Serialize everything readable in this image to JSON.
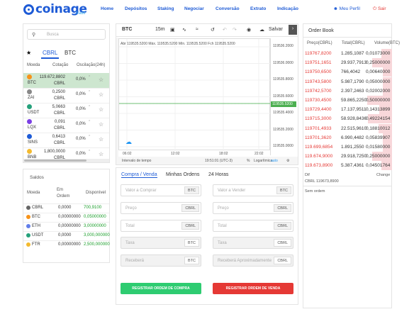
{
  "brand": {
    "name": "coinage",
    "sub": "trade"
  },
  "nav": {
    "items": [
      "Home",
      "Depósitos",
      "Staking",
      "Negociar",
      "Conversão",
      "Extrato",
      "Indicação"
    ],
    "user": "Meu Perfil",
    "exit": "Sair"
  },
  "market": {
    "search_placeholder": "Busca",
    "tabs": [
      "CBRL",
      "BTC"
    ],
    "headers": [
      "Moeda",
      "Cotação",
      "Oscilação(24h)"
    ],
    "rows": [
      {
        "sym": "BTC",
        "price1": "119.672,8802",
        "price2": "CBRL",
        "var": "0,0%",
        "color": "#f7931a"
      },
      {
        "sym": "ZAI",
        "price1": "0,2500",
        "price2": "CBRL",
        "var": "0,0%",
        "color": "#888888"
      },
      {
        "sym": "USDT",
        "price1": "5,0663",
        "price2": "CBRL",
        "var": "0,0%",
        "color": "#26a17b"
      },
      {
        "sym": "LQX",
        "price1": "0,091",
        "price2": "CBRL",
        "var": "0,0%",
        "color": "#7b3fe4"
      },
      {
        "sym": "SINS",
        "price1": "0,6413",
        "price2": "CBRL",
        "var": "0,0%",
        "color": "#1e5bd6"
      },
      {
        "sym": "BNB",
        "price1": "1,800,0000",
        "price2": "CBRL",
        "var": "0,0%",
        "color": "#f3ba2f"
      }
    ]
  },
  "balances": {
    "title": "Saldos",
    "headers": [
      "Moeda",
      "Em Ordem",
      "Disponível"
    ],
    "rows": [
      {
        "sym": "CBRL",
        "in_order": "0,0000",
        "avail": "700,9100",
        "color": "#666666"
      },
      {
        "sym": "BTC",
        "in_order": "0,00000000",
        "avail": "0,05000000",
        "color": "#f7931a"
      },
      {
        "sym": "ETH",
        "in_order": "0,00000000",
        "avail": "3,00000000",
        "color": "#627eea"
      },
      {
        "sym": "USDT",
        "in_order": "0,0000",
        "avail": "3,000,000000",
        "color": "#26a17b"
      },
      {
        "sym": "FTR",
        "in_order": "0,00000000",
        "avail": "2,500,000000",
        "color": "#f3ba2f"
      }
    ]
  },
  "chart": {
    "symbol": "BTC",
    "interval": "15m",
    "save": "Salvar",
    "legend": "Abr 119535.5200  Máx. 119535.5200  Mín. 119535.5200  Fch 119535.5200",
    "yticks": [
      "119536.2000",
      "119536.0000",
      "119535.8000",
      "119535.6000",
      "119535.4000",
      "119535.2000",
      "119535.0000",
      "119534.8000"
    ],
    "price_tag": "119535.5200",
    "xticks": [
      "06:02",
      "12:02",
      "18:02",
      "22:02"
    ],
    "footer": {
      "range": "Intervalo de tempo",
      "time": "19:51:01 (UTC-3)",
      "pct": "%",
      "log": "Logarítmica",
      "auto": "auto"
    }
  },
  "form": {
    "tabs": [
      "Compra / Venda",
      "Minhas Ordens",
      "24 Horas"
    ],
    "buy": [
      {
        "ph": "Valor a Comprar",
        "unit": "BTC"
      },
      {
        "ph": "Preço",
        "unit": "CBRL"
      },
      {
        "ph": "Total",
        "unit": "CBRL"
      },
      {
        "ph": "Taxa",
        "unit": "BTC"
      },
      {
        "ph": "Receberá",
        "unit": "BTC"
      }
    ],
    "sell": [
      {
        "ph": "Valor a Vender",
        "unit": "BTC"
      },
      {
        "ph": "Preço",
        "unit": "CBRL"
      },
      {
        "ph": "Total",
        "unit": "CBRL"
      },
      {
        "ph": "Taxa",
        "unit": "CBRL"
      },
      {
        "ph": "Receberá Aproximadamente",
        "unit": "CBRL"
      }
    ],
    "buy_btn": "REGISTRAR ORDEM DE COMPRA",
    "sell_btn": "REGISTRAR ORDEM DE VENDA"
  },
  "orderbook": {
    "title": "Order Book",
    "headers": [
      "Preço(CBRL)",
      "Total(CBRL)",
      "Volume(BTC)"
    ],
    "rows": [
      {
        "p": "119767,8200",
        "q": "1.285,1087",
        "v": "0,01073000",
        "fill": 0.12
      },
      {
        "p": "119751,1651",
        "q": "29.937,7913",
        "v": "0,25000000",
        "fill": 0.22
      },
      {
        "p": "119750,6500",
        "q": "766,4042",
        "v": "0,00640000",
        "fill": 0.1
      },
      {
        "p": "119743,5800",
        "q": "5.987,1790",
        "v": "0,05000000",
        "fill": 0.1
      },
      {
        "p": "119742,5700",
        "q": "2.397,2463",
        "v": "0,02002000",
        "fill": 0.1
      },
      {
        "p": "119730,4500",
        "q": "59.865,2250",
        "v": "0,50000000",
        "fill": 0.28
      },
      {
        "p": "119729,4400",
        "q": "17.137,9511",
        "v": "0,14313899",
        "fill": 0.14
      },
      {
        "p": "119715,3000",
        "q": "58.928,8436",
        "v": "0,49224154",
        "fill": 0.27
      },
      {
        "p": "119701,4933",
        "q": "22.515,9610",
        "v": "0,18810012",
        "fill": 0.15
      },
      {
        "p": "119701,3620",
        "q": "6.990,4482",
        "v": "0,05839907",
        "fill": 0.1
      },
      {
        "p": "119.699,6854",
        "q": "1.891,2550",
        "v": "0,01580000",
        "fill": 0.1
      },
      {
        "p": "119.674,9000",
        "q": "29.918,7250",
        "v": "0,25000000",
        "fill": 0.22
      },
      {
        "p": "119.673,8900",
        "q": "5.387,4361",
        "v": "0,04501764",
        "fill": 0.12
      }
    ],
    "dif": "Dif",
    "change": "Change",
    "last": "CBRL 119673,8900",
    "empty": "Sem ordem"
  }
}
